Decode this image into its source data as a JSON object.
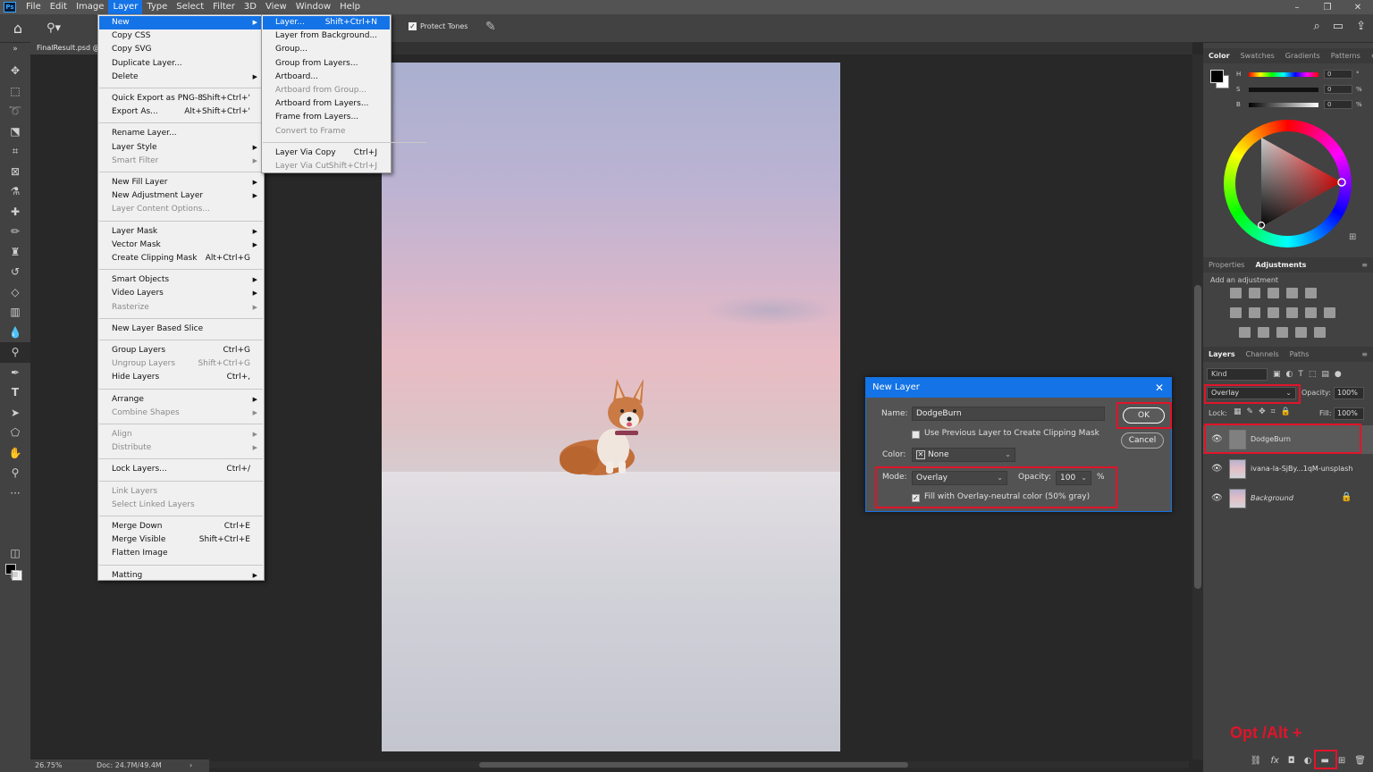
{
  "menubar": {
    "logo": "Ps",
    "items": [
      "File",
      "Edit",
      "Image",
      "Layer",
      "Type",
      "Select",
      "Filter",
      "3D",
      "View",
      "Window",
      "Help"
    ],
    "active": "Layer",
    "window_controls": [
      "–",
      "❐",
      "✕"
    ]
  },
  "options": {
    "protect_tones_label": "Protect Tones",
    "protect_tones_checked": true
  },
  "document": {
    "tab_title": "FinalResult.psd @",
    "zoom": "26.75%",
    "doc_size": "Doc: 24.7M/49.4M"
  },
  "layer_menu": {
    "items": [
      {
        "label": "New",
        "highlight": true,
        "submenu": true
      },
      {
        "label": "Copy CSS"
      },
      {
        "label": "Copy SVG"
      },
      {
        "label": "Duplicate Layer..."
      },
      {
        "label": "Delete",
        "submenu": true
      },
      {
        "sep": true
      },
      {
        "label": "Quick Export as PNG-8",
        "shortcut": "Shift+Ctrl+'"
      },
      {
        "label": "Export As...",
        "shortcut": "Alt+Shift+Ctrl+'"
      },
      {
        "sep": true
      },
      {
        "label": "Rename Layer..."
      },
      {
        "label": "Layer Style",
        "submenu": true
      },
      {
        "label": "Smart Filter",
        "disabled": true,
        "submenu": true
      },
      {
        "sep": true
      },
      {
        "label": "New Fill Layer",
        "submenu": true
      },
      {
        "label": "New Adjustment Layer",
        "submenu": true
      },
      {
        "label": "Layer Content Options...",
        "disabled": true
      },
      {
        "sep": true
      },
      {
        "label": "Layer Mask",
        "submenu": true
      },
      {
        "label": "Vector Mask",
        "submenu": true
      },
      {
        "label": "Create Clipping Mask",
        "shortcut": "Alt+Ctrl+G"
      },
      {
        "sep": true
      },
      {
        "label": "Smart Objects",
        "submenu": true
      },
      {
        "label": "Video Layers",
        "submenu": true
      },
      {
        "label": "Rasterize",
        "disabled": true,
        "submenu": true
      },
      {
        "sep": true
      },
      {
        "label": "New Layer Based Slice"
      },
      {
        "sep": true
      },
      {
        "label": "Group Layers",
        "shortcut": "Ctrl+G"
      },
      {
        "label": "Ungroup Layers",
        "shortcut": "Shift+Ctrl+G",
        "disabled": true
      },
      {
        "label": "Hide Layers",
        "shortcut": "Ctrl+,"
      },
      {
        "sep": true
      },
      {
        "label": "Arrange",
        "submenu": true
      },
      {
        "label": "Combine Shapes",
        "disabled": true,
        "submenu": true
      },
      {
        "sep": true
      },
      {
        "label": "Align",
        "disabled": true,
        "submenu": true
      },
      {
        "label": "Distribute",
        "disabled": true,
        "submenu": true
      },
      {
        "sep": true
      },
      {
        "label": "Lock Layers...",
        "shortcut": "Ctrl+/"
      },
      {
        "sep": true
      },
      {
        "label": "Link Layers",
        "disabled": true
      },
      {
        "label": "Select Linked Layers",
        "disabled": true
      },
      {
        "sep": true
      },
      {
        "label": "Merge Down",
        "shortcut": "Ctrl+E"
      },
      {
        "label": "Merge Visible",
        "shortcut": "Shift+Ctrl+E"
      },
      {
        "label": "Flatten Image"
      },
      {
        "sep": true
      },
      {
        "label": "Matting",
        "submenu": true
      }
    ]
  },
  "new_submenu": {
    "items": [
      {
        "label": "Layer...",
        "shortcut": "Shift+Ctrl+N",
        "highlight": true
      },
      {
        "label": "Layer from Background..."
      },
      {
        "label": "Group..."
      },
      {
        "label": "Group from Layers..."
      },
      {
        "label": "Artboard..."
      },
      {
        "label": "Artboard from Group...",
        "disabled": true
      },
      {
        "label": "Artboard from Layers..."
      },
      {
        "label": "Frame from Layers..."
      },
      {
        "label": "Convert to Frame",
        "disabled": true
      },
      {
        "sep": true
      },
      {
        "label": "Layer Via Copy",
        "shortcut": "Ctrl+J"
      },
      {
        "label": "Layer Via Cut",
        "shortcut": "Shift+Ctrl+J",
        "disabled": true
      }
    ]
  },
  "dialog": {
    "title": "New Layer",
    "name_label": "Name:",
    "name_value": "DodgeBurn",
    "clip_label": "Use Previous Layer to Create Clipping Mask",
    "clip_checked": false,
    "color_label": "Color:",
    "color_value": "None",
    "mode_label": "Mode:",
    "mode_value": "Overlay",
    "opacity_label": "Opacity:",
    "opacity_value": "100",
    "opacity_unit": "%",
    "fill_label": "Fill with Overlay-neutral color (50% gray)",
    "fill_checked": true,
    "ok": "OK",
    "cancel": "Cancel",
    "close": "✕"
  },
  "color_panel": {
    "tabs": [
      "Color",
      "Swatches",
      "Gradients",
      "Patterns"
    ],
    "active_tab": "Color",
    "h_label": "H",
    "h_value": "0",
    "h_unit": "°",
    "s_label": "S",
    "s_value": "0",
    "s_unit": "%",
    "b_label": "B",
    "b_value": "0",
    "b_unit": "%"
  },
  "adjust_panel": {
    "tabs": [
      "Properties",
      "Adjustments"
    ],
    "active_tab": "Adjustments",
    "hint": "Add an adjustment"
  },
  "layers_panel": {
    "tabs": [
      "Layers",
      "Channels",
      "Paths"
    ],
    "active_tab": "Layers",
    "kind": "Kind",
    "blend_mode": "Overlay",
    "opacity_label": "Opacity:",
    "opacity": "100%",
    "lock_label": "Lock:",
    "fill_label": "Fill:",
    "fill": "100%",
    "layers": [
      {
        "name": "DodgeBurn",
        "selected": true
      },
      {
        "name": "ivana-la-SjBy...1qM-unsplash",
        "selected": false
      },
      {
        "name": "Background",
        "selected": false,
        "locked": true
      }
    ]
  },
  "annotation": {
    "text": "Opt /Alt +"
  },
  "colors": {
    "accent": "#1473e6",
    "highlight_red": "#e0142a",
    "panel_bg": "#424242",
    "canvas_bg": "#282828"
  }
}
